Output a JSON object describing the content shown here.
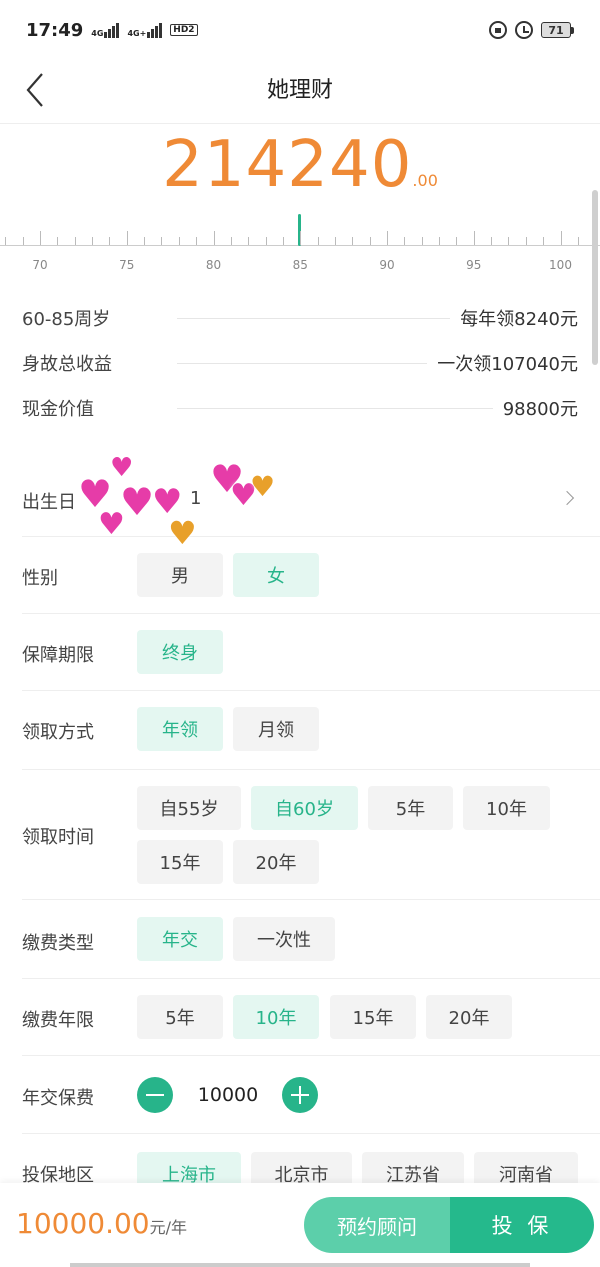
{
  "status": {
    "time": "17:49",
    "net1": "4G",
    "net2": "4G+",
    "hd": "HD2",
    "battery": "71"
  },
  "nav": {
    "title": "她理财"
  },
  "amount": {
    "integer": "214240",
    "decimal": ".00"
  },
  "ruler": {
    "labels": [
      "70",
      "75",
      "80",
      "85",
      "90",
      "95",
      "100"
    ],
    "selected_age": 85
  },
  "summary": [
    {
      "label": "60-85周岁",
      "value": "每年领8240元"
    },
    {
      "label": "身故总收益",
      "value": "一次领107040元"
    },
    {
      "label": "现金价值",
      "value": "98800元"
    }
  ],
  "birthday": {
    "label": "出生日",
    "value": "1"
  },
  "gender": {
    "label": "性别",
    "options": [
      "男",
      "女"
    ],
    "selected": "女"
  },
  "term": {
    "label": "保障期限",
    "options": [
      "终身"
    ],
    "selected": "终身"
  },
  "receive_method": {
    "label": "领取方式",
    "options": [
      "年领",
      "月领"
    ],
    "selected": "年领"
  },
  "receive_time": {
    "label": "领取时间",
    "options": [
      "自55岁",
      "自60岁",
      "5年",
      "10年",
      "15年",
      "20年"
    ],
    "selected": "自60岁"
  },
  "pay_type": {
    "label": "缴费类型",
    "options": [
      "年交",
      "一次性"
    ],
    "selected": "年交"
  },
  "pay_years": {
    "label": "缴费年限",
    "options": [
      "5年",
      "10年",
      "15年",
      "20年"
    ],
    "selected": "10年"
  },
  "premium": {
    "label": "年交保费",
    "value": "10000"
  },
  "region": {
    "label": "投保地区",
    "options": [
      "上海市",
      "北京市",
      "江苏省",
      "河南省"
    ],
    "selected": "上海市"
  },
  "footer": {
    "price": "10000.00",
    "unit": "元/年",
    "consult": "预约顾问",
    "insure": "投 保"
  },
  "colors": {
    "accent": "#27b48a",
    "amount": "#ef8a36"
  },
  "icons": [
    "back-icon",
    "chevron-right-icon",
    "minus-icon",
    "plus-icon",
    "lock-icon",
    "alarm-icon",
    "battery-icon",
    "heart-sticker"
  ]
}
